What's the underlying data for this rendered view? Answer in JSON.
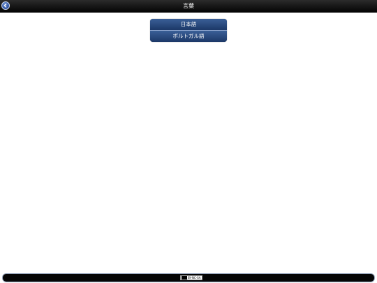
{
  "header": {
    "title": "言葉",
    "back_icon": "back-arrow-icon"
  },
  "languages": [
    {
      "label": "日本語"
    },
    {
      "label": "ポルトガル語"
    }
  ],
  "footer": {
    "license_text": "BY-NC-SA"
  },
  "colors": {
    "bar": "#0a0a0a",
    "menu": "#2b4d82",
    "menu_divider": "#8fa7cf"
  }
}
